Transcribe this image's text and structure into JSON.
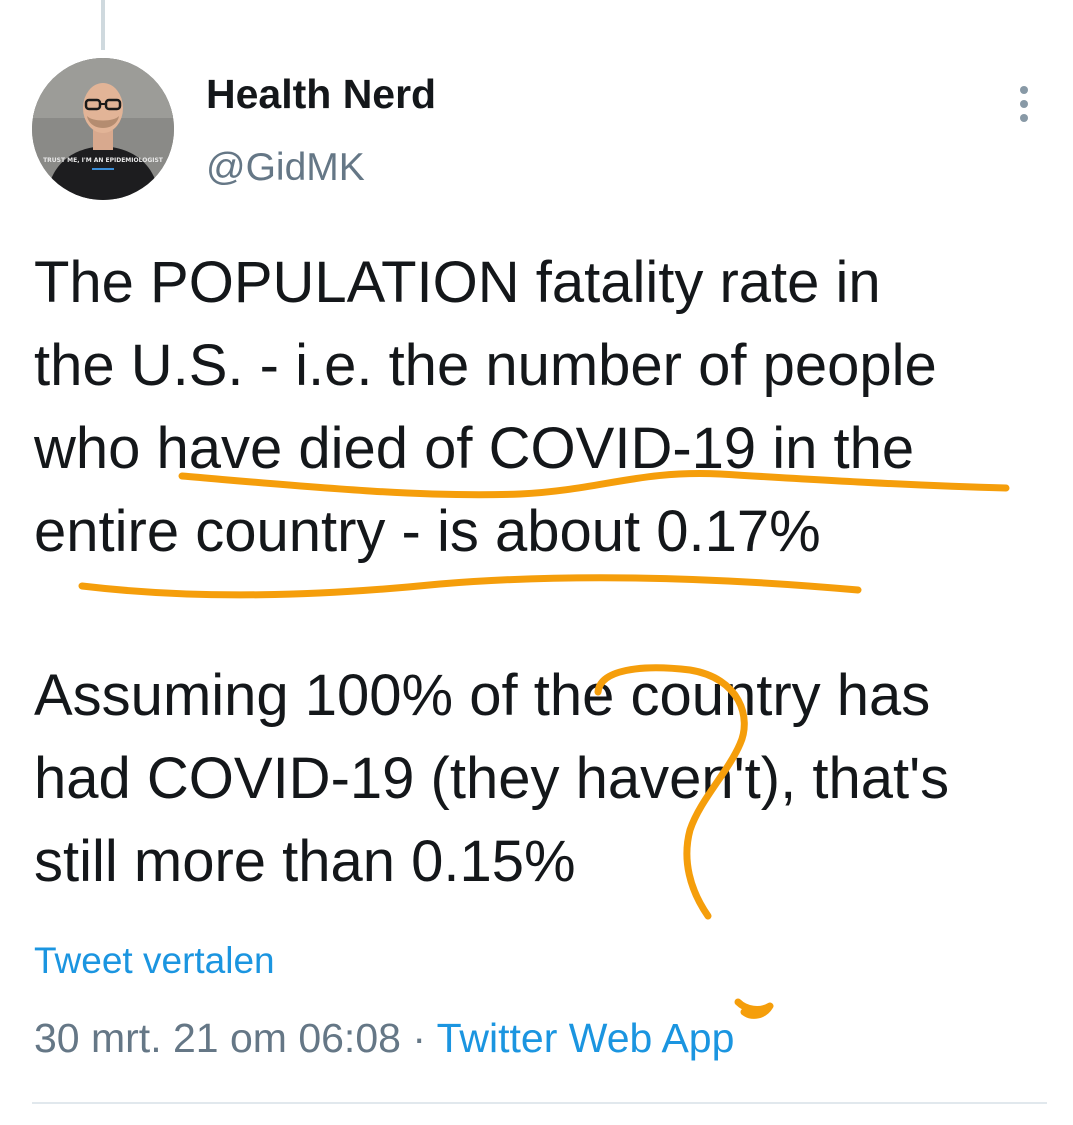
{
  "author": {
    "name": "Health Nerd",
    "handle": "@GidMK",
    "avatar_shirt_text": "TRUST ME, I'M AN EPIDEMIOLOGIST"
  },
  "tweet": {
    "paragraph1": [
      "The POPULATION fatality rate in",
      "the U.S. - i.e. the number of people",
      "who have died of COVID-19 in the",
      "entire country - is about 0.17%"
    ],
    "paragraph2": [
      "Assuming 100% of the country has",
      "had COVID-19 (they haven't), that's",
      "still more than 0.15%"
    ],
    "translate_label": "Tweet vertalen",
    "timestamp": "30 mrt. 21 om 06:08",
    "separator": "·",
    "source": "Twitter Web App"
  },
  "icons": {
    "more": "more-vertical-icon"
  },
  "colors": {
    "text": "#14171a",
    "secondary": "#657786",
    "link": "#1b95e0",
    "annotation": "#f59e0b"
  }
}
